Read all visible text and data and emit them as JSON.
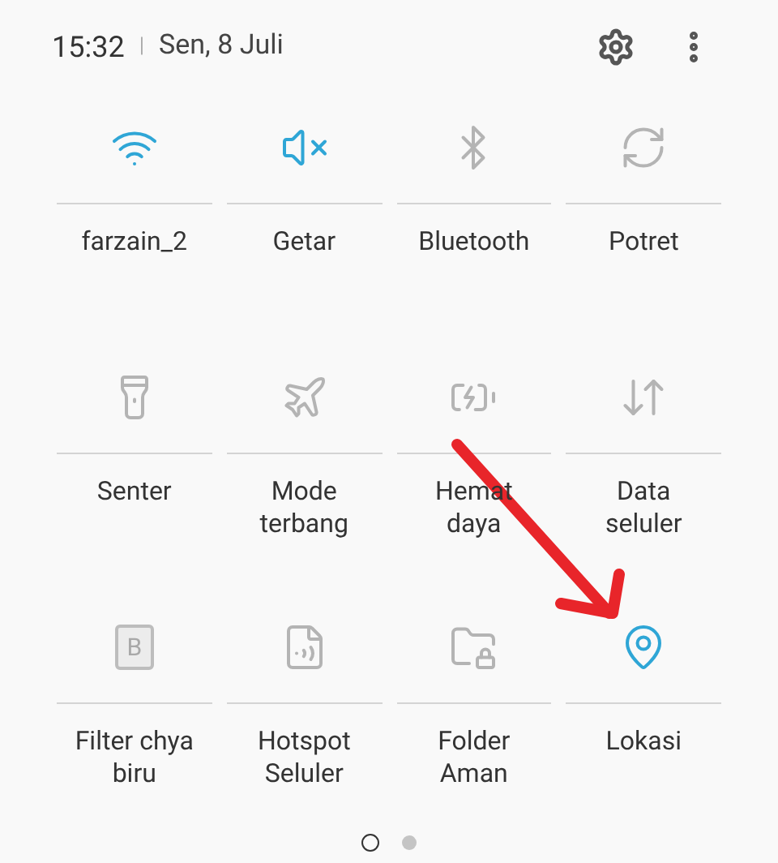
{
  "header": {
    "time": "15:32",
    "separator": "|",
    "date": "Sen, 8 Juli"
  },
  "tiles": [
    {
      "kind": "wifi",
      "label": "farzain_2",
      "on": true
    },
    {
      "kind": "vibrate",
      "label": "Getar",
      "on": true
    },
    {
      "kind": "bluetooth",
      "label": "Bluetooth",
      "on": false
    },
    {
      "kind": "rotate",
      "label": "Potret",
      "on": false
    },
    {
      "kind": "flashlight",
      "label": "Senter",
      "on": false
    },
    {
      "kind": "plane",
      "label": "Mode terbang",
      "on": false
    },
    {
      "kind": "battery",
      "label": "Hemat daya",
      "on": false
    },
    {
      "kind": "data",
      "label": "Data seluler",
      "on": false
    },
    {
      "kind": "filter",
      "label": "Filter chya biru",
      "on": false,
      "icon_text": "B"
    },
    {
      "kind": "hotspot",
      "label": "Hotspot Seluler",
      "on": false
    },
    {
      "kind": "folder",
      "label": "Folder Aman",
      "on": false
    },
    {
      "kind": "location",
      "label": "Lokasi",
      "on": true
    }
  ],
  "pages": [
    {
      "selected": true
    },
    {
      "selected": false
    }
  ]
}
